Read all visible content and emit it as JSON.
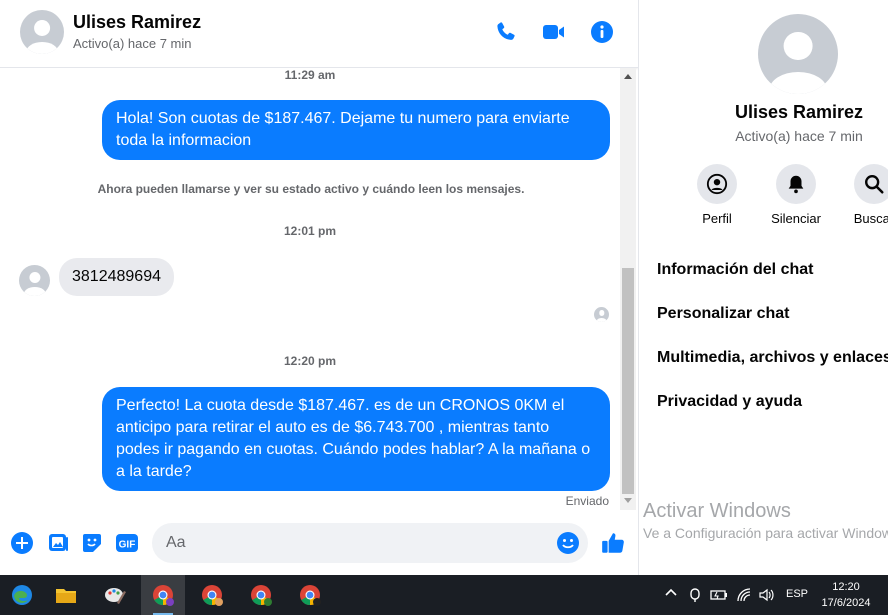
{
  "header": {
    "name": "Ulises Ramirez",
    "status": "Activo(a) hace 7 min",
    "icons": [
      "phone-icon",
      "video-icon",
      "info-icon"
    ]
  },
  "conversation": {
    "timestamps": [
      "11:29 am",
      "12:01 pm",
      "12:20 pm"
    ],
    "messages": [
      {
        "from": "me",
        "text": "Hola! Son cuotas de $187.467. Dejame tu numero para enviarte toda la informacion"
      },
      {
        "from": "them",
        "text": "3812489694"
      },
      {
        "from": "me",
        "text": "Perfecto! La cuota desde $187.467. es de un CRONOS 0KM el anticipo para retirar el auto es de $6.743.700 , mientras tanto podes ir pagando en cuotas. Cuándo podes hablar? A la mañana o a la tarde?"
      }
    ],
    "system_notice": "Ahora pueden llamarse y ver su estado activo y cuándo leen los mensajes.",
    "delivery_status": "Enviado"
  },
  "composer": {
    "placeholder": "Aa",
    "icons": [
      "plus-icon",
      "photo-icon",
      "sticker-icon",
      "gif-icon",
      "emoji-icon",
      "like-icon"
    ]
  },
  "panel": {
    "name": "Ulises Ramirez",
    "status": "Activo(a) hace 7 min",
    "actions": [
      {
        "label": "Perfil",
        "icon": "profile-icon"
      },
      {
        "label": "Silenciar",
        "icon": "bell-icon"
      },
      {
        "label": "Buscar",
        "icon": "search-icon"
      }
    ],
    "menu": [
      "Información del chat",
      "Personalizar chat",
      "Multimedia, archivos y enlaces",
      "Privacidad y ayuda"
    ],
    "watermark_title": "Activar Windows",
    "watermark_text": "Ve a Configuración para activar Windows."
  },
  "taskbar": {
    "language": "ESP",
    "time": "12:20",
    "date": "17/6/2024"
  },
  "colors": {
    "accent": "#0a7cff",
    "bubble_in": "#e9eaee",
    "taskbar": "#1a1e24"
  }
}
